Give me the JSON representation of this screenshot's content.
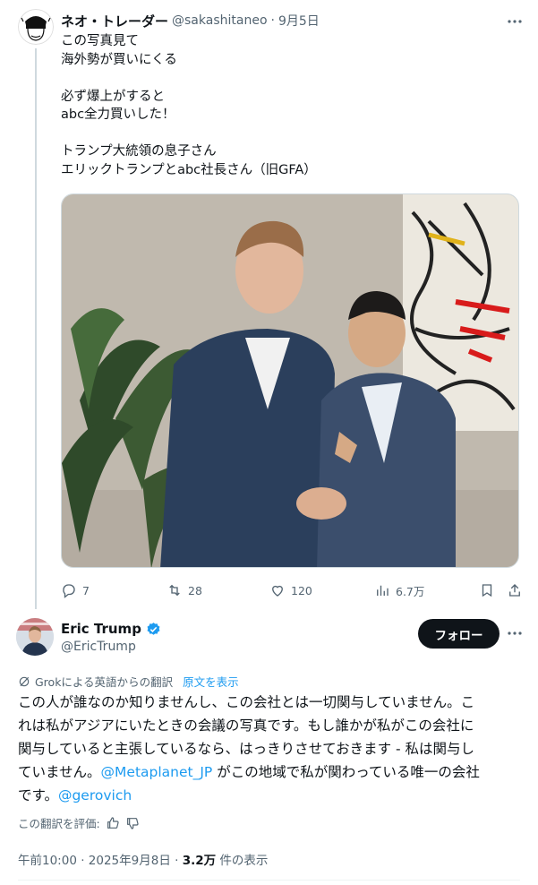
{
  "first_tweet": {
    "display_name": "ネオ・トレーダー",
    "handle": "@sakashitaneo",
    "separator": "·",
    "date": "9月5日",
    "lines": [
      "この写真見て",
      "海外勢が買いにくる",
      "",
      "必ず爆上がすると",
      "abc全力買いした！",
      "",
      "トランプ大統領の息子さん",
      "エリックトランプとabc社長さん（旧GFA）"
    ],
    "actions": {
      "replies": "7",
      "reposts": "28",
      "likes": "120",
      "views": "6.7万"
    },
    "icons": [
      "more-icon",
      "reply-icon",
      "repost-icon",
      "like-icon",
      "views-icon",
      "bookmark-icon",
      "share-icon"
    ]
  },
  "second_tweet": {
    "display_name": "Eric Trump",
    "handle": "@EricTrump",
    "verified": true,
    "follow_label": "フォロー",
    "translation_note": "Grokによる英語からの翻訳",
    "show_original": "原文を表示",
    "body_lines": [
      [
        {
          "t": " この人が誰なのか知りませんし、この会社とは一切関与していません。こ",
          "m": false
        }
      ],
      [
        {
          "t": "れは私がアジアにいたときの会議の写真です。もし誰かが私がこの会社に",
          "m": false
        }
      ],
      [
        {
          "t": "関与していると主張しているなら、はっきりさせておきます - 私は関与し",
          "m": false
        }
      ],
      [
        {
          "t": "ていません。",
          "m": false
        },
        {
          "t": "@Metaplanet_JP",
          "m": true
        },
        {
          "t": " がこの地域で私が関わっている唯一の会社",
          "m": false
        }
      ],
      [
        {
          "t": "です。",
          "m": false
        },
        {
          "t": "@gerovich",
          "m": true
        }
      ]
    ],
    "rate_label": "この翻訳を評価:",
    "timestamp": "午前10:00 · 2025年9月8日 · ",
    "view_count": "3.2万",
    "view_suffix": " 件の表示"
  },
  "colors": {
    "text": "#0f1419",
    "secondary": "#536471",
    "link": "#1d9bf0",
    "verified": "#1d9bf0",
    "button": "#0f1419",
    "divider": "#cfd9de"
  }
}
